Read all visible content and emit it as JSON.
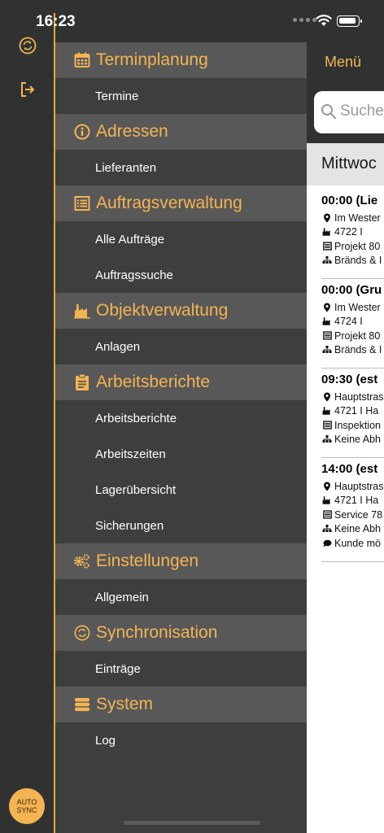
{
  "status": {
    "time": "16:23"
  },
  "rail": {
    "auto_sync": [
      "AUTO",
      "SYNC"
    ]
  },
  "menu": {
    "sections": [
      {
        "title": "Terminplanung",
        "icon": "calendar-icon",
        "items": [
          "Termine"
        ]
      },
      {
        "title": "Adressen",
        "icon": "info-icon",
        "items": [
          "Lieferanten"
        ]
      },
      {
        "title": "Auftragsverwaltung",
        "icon": "list-icon",
        "items": [
          "Alle Aufträge",
          "Auftragssuche"
        ]
      },
      {
        "title": "Objektverwaltung",
        "icon": "factory-icon",
        "items": [
          "Anlagen"
        ]
      },
      {
        "title": "Arbeitsberichte",
        "icon": "clipboard-icon",
        "items": [
          "Arbeitsberichte",
          "Arbeitszeiten",
          "Lagerübersicht",
          "Sicherungen"
        ]
      },
      {
        "title": "Einstellungen",
        "icon": "gears-icon",
        "items": [
          "Allgemein"
        ]
      },
      {
        "title": "Synchronisation",
        "icon": "sync-icon",
        "items": [
          "Einträge"
        ]
      },
      {
        "title": "System",
        "icon": "database-icon",
        "items": [
          "Log"
        ]
      }
    ]
  },
  "content": {
    "nav_label": "Menü",
    "search_placeholder": "Suche",
    "date_header": "Mittwoc",
    "appointments": [
      {
        "time": "00:00 (Lie",
        "address": "Im Wester",
        "object": "4722  I",
        "order": "Projekt 80",
        "team": "Bränds & I"
      },
      {
        "time": "00:00 (Gru",
        "address": "Im Wester",
        "object": "4724  I",
        "order": "Projekt 80",
        "team": "Bränds & I"
      },
      {
        "time": "09:30 (est",
        "address": "Hauptstras",
        "object": "4721  I  Ha",
        "order": "Inspektion",
        "team": "Keine Abh"
      },
      {
        "time": "14:00 (est",
        "address": "Hauptstras",
        "object": "4721  I  Ha",
        "order": "Service 78",
        "team": "Keine Abh",
        "note": "Kunde mö"
      }
    ]
  },
  "colors": {
    "accent": "#f4b452",
    "panel": "#3d3f3d",
    "header": "#585858",
    "rail_line": "#f0a830"
  }
}
